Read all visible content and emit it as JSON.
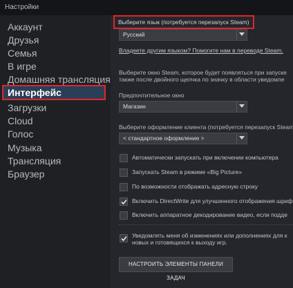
{
  "window": {
    "title": "Настройки"
  },
  "sidebar": {
    "items": [
      {
        "label": "Аккаунт"
      },
      {
        "label": "Друзья"
      },
      {
        "label": "Семья"
      },
      {
        "label": "В игре"
      },
      {
        "label": "Домашняя трансляция"
      },
      {
        "label": "Интерфейс",
        "active": true
      },
      {
        "label": "Загрузки"
      },
      {
        "label": "Cloud"
      },
      {
        "label": "Голос"
      },
      {
        "label": "Музыка"
      },
      {
        "label": "Трансляция"
      },
      {
        "label": "Браузер"
      }
    ]
  },
  "interface": {
    "language_label": "Выберите язык (потребуется перезапуск Steam)",
    "language_value": "Русский",
    "translate_link": "Владеете другим языком? Помогите нам в переводе Steam.",
    "window_desc_1": "Выберите окно Steam, которое будет появляться при запуске",
    "window_desc_2": "также после двойного щелчка по значку в области уведомле",
    "preferred_window_label": "Предпочтительное окно",
    "preferred_window_value": "Магазин",
    "skin_label": "Выберите оформление клиента (потребуется перезапуск Steam",
    "skin_value": "< стандартное оформление >",
    "checkboxes": [
      {
        "label": "Автоматически запускать при включении компьютера",
        "checked": false
      },
      {
        "label": "Запускать Steam в режиме «Big Picture»",
        "checked": false
      },
      {
        "label": "По возможности отображать адресную строку",
        "checked": false
      },
      {
        "label": "Включить DirectWrite для улучшенного отображения шриф",
        "checked": true
      },
      {
        "label": "Включить аппаратное декодирование видео, если подде",
        "checked": false
      }
    ],
    "notify_line_1": "Уведомлять меня об изменениях или дополнениях для к",
    "notify_line_2": "новых и готовящихся к выходу игр.",
    "notify_checked": true,
    "taskbar_button": "НАСТРОИТЬ ЭЛЕМЕНТЫ ПАНЕЛИ ЗАДАЧ"
  },
  "colors": {
    "highlight_border": "#e0262b",
    "active_item_bg": "#2a3f57",
    "panel_bg": "#25262b"
  }
}
